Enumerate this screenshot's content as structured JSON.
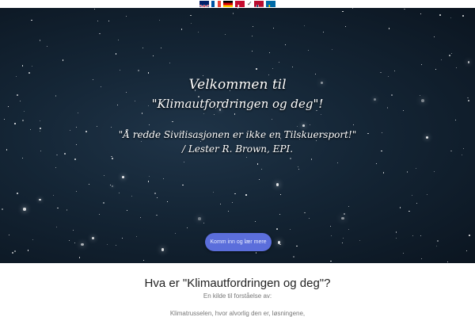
{
  "languages": [
    {
      "code": "en",
      "name": "English",
      "colors": [
        "#012169",
        "#ffffff",
        "#c8102e"
      ]
    },
    {
      "code": "fr",
      "name": "Français",
      "colors": [
        "#0055a4",
        "#ffffff",
        "#ef4135"
      ]
    },
    {
      "code": "de",
      "name": "Deutsch",
      "colors": [
        "#000000",
        "#dd0000",
        "#ffce00"
      ]
    },
    {
      "code": "da",
      "name": "Dansk",
      "colors": [
        "#c60c30",
        "#ffffff"
      ]
    },
    {
      "code": "no",
      "name": "Norsk",
      "colors": [
        "#ba0c2f",
        "#ffffff",
        "#00205b"
      ],
      "selected": true
    },
    {
      "code": "sv",
      "name": "Svenska",
      "colors": [
        "#006aa7",
        "#fecc00"
      ]
    }
  ],
  "hero": {
    "title_line1": "Velkommen til",
    "title_line2": "\"Klimautfordringen og deg\"!",
    "quote": "\"Å redde Sivilisasjonen er ikke en Tilskuersport!\"",
    "attribution": "/ Lester R. Brown, EPI.",
    "cta_label": "Komm inn og lær mere"
  },
  "section": {
    "heading": "Hva er \"Klimautfordringen og deg\"?",
    "subheading": "En kilde til forståelse av:",
    "paragraph": "Klimatrusselen, hvor alvorlig den er, løsningene,"
  },
  "colors": {
    "button": "#5b6edb",
    "hero_bg": "#142535"
  }
}
